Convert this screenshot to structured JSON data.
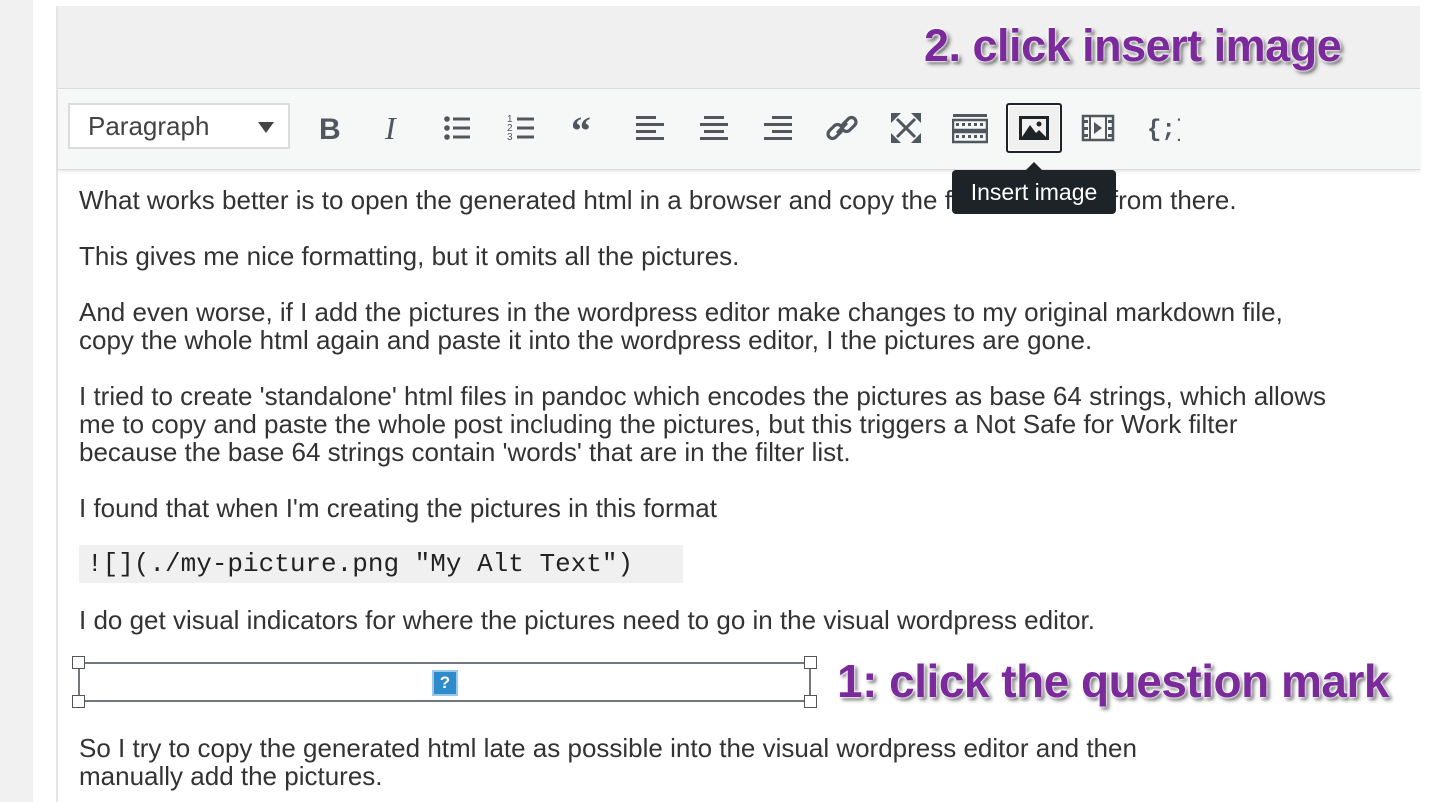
{
  "annotations": {
    "insert_image": "2. click insert image",
    "question_mark": "1: click the question mark"
  },
  "toolbar": {
    "format_select": "Paragraph",
    "buttons": [
      {
        "name": "bold-icon",
        "label": "Bold"
      },
      {
        "name": "italic-icon",
        "label": "Italic"
      },
      {
        "name": "bulleted-list-icon",
        "label": "Bulleted list"
      },
      {
        "name": "numbered-list-icon",
        "label": "Numbered list"
      },
      {
        "name": "blockquote-icon",
        "label": "Blockquote"
      },
      {
        "name": "align-left-icon",
        "label": "Align left"
      },
      {
        "name": "align-center-icon",
        "label": "Align center"
      },
      {
        "name": "align-right-icon",
        "label": "Align right"
      },
      {
        "name": "link-icon",
        "label": "Insert/edit link"
      },
      {
        "name": "fullscreen-icon",
        "label": "Fullscreen"
      },
      {
        "name": "toolbar-toggle-icon",
        "label": "Toolbar Toggle"
      },
      {
        "name": "insert-image-icon",
        "label": "Insert image"
      },
      {
        "name": "insert-video-icon",
        "label": "Insert video"
      },
      {
        "name": "shortcode-icon",
        "label": "Shortcode"
      }
    ],
    "tooltip": "Insert image"
  },
  "content": {
    "p1": "What works better is to open the generated html in a browser and copy the formatted text from there.",
    "p2": "This gives me nice formatting, but it omits all the pictures.",
    "p3": "And even worse, if I add the pictures in the wordpress editor make changes to my original markdown file, copy the whole html again and paste it into the wordpress editor, I the pictures are gone.",
    "p4": "I tried to create 'standalone' html files in pandoc which encodes the pictures as base 64 strings, which allows me to copy and paste the whole post including the pictures, but this triggers a Not Safe for Work filter because the base 64 strings contain 'words' that are in the filter list.",
    "p5": "I found that when I'm creating the pictures in this format",
    "code": "![](./my-picture.png \"My Alt Text\")",
    "p6": "I do get visual indicators for where the pictures need to go in the visual wordpress editor.",
    "placeholder_icon": "?",
    "p7": "So I try to copy the generated html late as possible into the visual wordpress editor and then manually add the pictures."
  },
  "colors": {
    "annotation": "#7a2a9a",
    "tooltip_bg": "#1d2327",
    "placeholder_icon": "#2e8ccc"
  }
}
